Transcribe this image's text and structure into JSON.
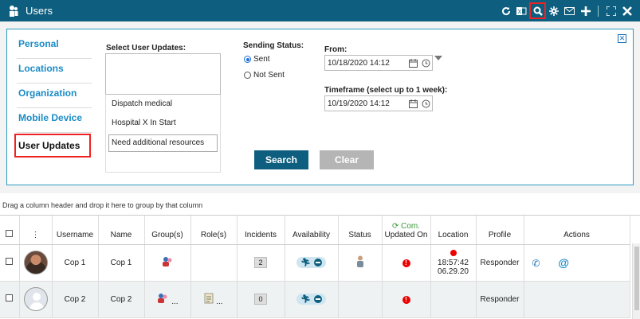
{
  "titlebar": {
    "title": "Users",
    "icons": [
      "users-icon",
      "refresh-icon",
      "excel-icon",
      "search-icon",
      "settings-icon",
      "mail-icon",
      "add-icon",
      "expand-icon",
      "close-icon"
    ]
  },
  "nav": {
    "items": [
      "Personal",
      "Locations",
      "Organization",
      "Mobile Device",
      "User Updates"
    ],
    "active": "User Updates"
  },
  "filters": {
    "select_label": "Select User Updates:",
    "options": [
      "Dispatch medical",
      "Hospital X In Start",
      "Need additional resources"
    ],
    "sending_status_label": "Sending Status:",
    "sent_label": "Sent",
    "not_sent_label": "Not Sent",
    "from_label": "From:",
    "from_value": "10/18/2020 14:12",
    "timeframe_label": "Timeframe (select up to 1 week):",
    "timeframe_value": "10/19/2020 14:12",
    "search_label": "Search",
    "clear_label": "Clear"
  },
  "grid": {
    "group_hint": "Drag a column header and drop it here to group by that column",
    "headers": {
      "username": "Username",
      "name": "Name",
      "groups": "Group(s)",
      "roles": "Role(s)",
      "incidents": "Incidents",
      "availability": "Availability",
      "status": "Status",
      "com": "Com.",
      "updated_on": "Updated On",
      "location": "Location",
      "profile": "Profile",
      "actions": "Actions"
    },
    "rows": [
      {
        "username": "Cop 1",
        "name": "Cop 1",
        "incidents": "2",
        "location_time": "18:57:42",
        "location_date": "06.29.20",
        "profile": "Responder",
        "ellipsis": ""
      },
      {
        "username": "Cop 2",
        "name": "Cop 2",
        "incidents": "0",
        "location_time": "",
        "location_date": "",
        "profile": "Responder",
        "ellipsis": "..."
      }
    ]
  },
  "colors": {
    "accent": "#0e5f7f",
    "link": "#1a8cc6",
    "alert": "#e00000"
  }
}
